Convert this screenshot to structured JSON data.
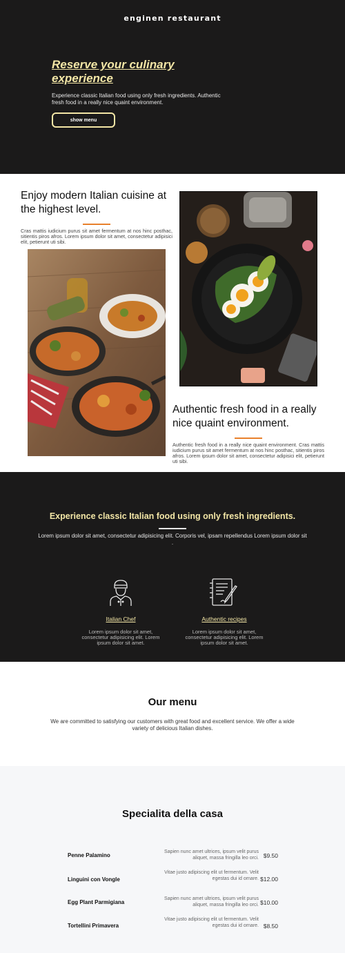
{
  "brand": "enginen restaurant",
  "hero": {
    "title": "Reserve your culinary experience",
    "subtitle": "Experience classic Italian food using only fresh ingredients. Authentic fresh food in a really nice quaint environment.",
    "button_label": "show menu"
  },
  "about": {
    "heading1": "Enjoy modern Italian cuisine at the highest level.",
    "para1": "Cras mattis iudicium purus sit amet fermentum at nos hinc posthac, sitientis piros afros. Lorem ipsum dolor sit amet, consectetur adipisici elit, petierunt uti sibi.",
    "heading2": "Authentic fresh food in a really nice quaint environment.",
    "para2": "Authentic fresh food in a really nice quaint environment. Cras mattis iudicium purus sit amet fermentum at nos hinc posthac, sitientis piros afros. Lorem ipsum dolor sit amet, consectetur adipisici elit, petierunt uti sibi."
  },
  "experience": {
    "title": "Experience classic Italian food using only fresh ingredients.",
    "subtitle": "Lorem ipsum dolor sit amet, consectetur adipisicing elit. Corporis vel, ipsam repellendus Lorem ipsum dolor sit .",
    "features": [
      {
        "icon": "chef-icon",
        "title": "Italian Chef",
        "text": "Lorem ipsum dolor sit amet, consectetur adipisicing elit. Lorem ipsum dolor sit amet."
      },
      {
        "icon": "recipe-book-icon",
        "title": "Authentic recipes",
        "text": "Lorem ipsum dolor sit amet, consectetur adipisicing elit. Lorem ipsum dolor sit amet."
      }
    ]
  },
  "our_menu": {
    "title": "Our menu",
    "text": "We are committed to satisfying our customers with great food and excellent service. We offer a wide variety of delicious Italian dishes."
  },
  "specialita": {
    "title": "Specialita della casa",
    "items": [
      {
        "name": "Penne Palamino",
        "description": "Sapien nunc amet ultrices, ipsum velit purus aliquet, massa fringilla leo orci.",
        "price": "$9.50"
      },
      {
        "name": "Linguini con Vongle",
        "description": "Vitae justo adipiscing elit ut fermentum. Velit egestas dui id ornare.",
        "price": "$12.00"
      },
      {
        "name": "Egg Plant Parmigiana",
        "description": "Sapien nunc amet ultrices, ipsum velit purus aliquet, massa fringilla leo orci.",
        "price": "$10.00"
      },
      {
        "name": "Tortellini Primavera",
        "description": "Vitae justo adipiscing elit ut fermentum. Velit egestas dui id ornare.",
        "price": "$8.50"
      }
    ]
  },
  "colors": {
    "dark_bg": "#1b1a1a",
    "accent_cream": "#f3e6a6",
    "accent_orange": "#e8802b",
    "light_bg": "#f6f7f9"
  }
}
